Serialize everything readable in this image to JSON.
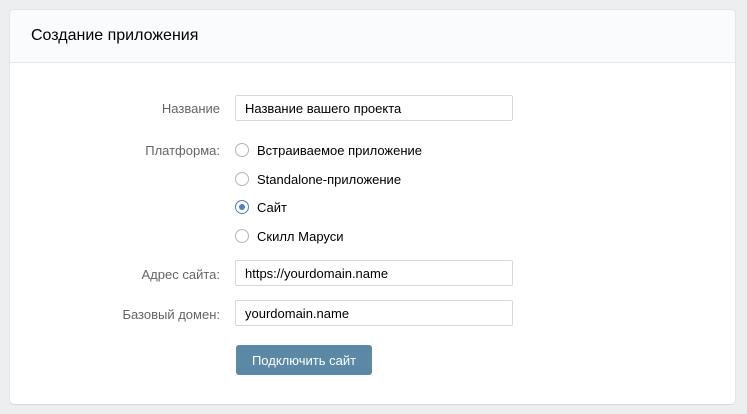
{
  "header": {
    "title": "Создание приложения"
  },
  "form": {
    "name_label": "Название",
    "name_value": "Название вашего проекта",
    "platform_label": "Платформа:",
    "platforms": [
      {
        "label": "Встраиваемое приложение",
        "checked": false
      },
      {
        "label": "Standalone-приложение",
        "checked": false
      },
      {
        "label": "Сайт",
        "checked": true
      },
      {
        "label": "Скилл Маруси",
        "checked": false
      }
    ],
    "site_address_label": "Адрес сайта:",
    "site_address_value": "https://yourdomain.name",
    "base_domain_label": "Базовый домен:",
    "base_domain_value": "yourdomain.name",
    "submit_label": "Подключить сайт"
  },
  "colors": {
    "page_background": "#edeef0",
    "accent": "#5181b8",
    "button": "#5b88a5"
  }
}
